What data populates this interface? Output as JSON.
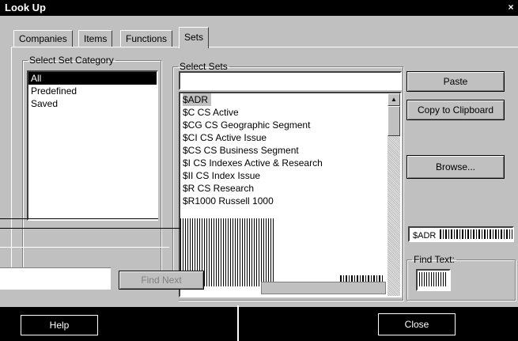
{
  "window": {
    "title": "Look Up",
    "close_glyph": "×"
  },
  "tabs": [
    {
      "label": "Companies",
      "active": false
    },
    {
      "label": "Items",
      "active": false
    },
    {
      "label": "Functions",
      "active": false
    },
    {
      "label": "Sets",
      "active": true
    }
  ],
  "category": {
    "legend": "Select Set Category",
    "items": [
      "All",
      "Predefined",
      "Saved"
    ],
    "selected": "All"
  },
  "sets": {
    "legend": "Select Sets",
    "search_value": "",
    "items": [
      "$ADR",
      "$C CS Active",
      "$CG CS Geographic Segment",
      "$CI CS Active Issue",
      "$CS CS Business Segment",
      "$I CS Indexes Active & Research",
      "$II CS Index Issue",
      "$R CS Research",
      "$R1000 Russell 1000"
    ],
    "selected": "$ADR"
  },
  "buttons": {
    "paste": "Paste",
    "copy": "Copy to Clipboard",
    "browse": "Browse...",
    "find_next": "Find Next",
    "help": "Help",
    "close": "Close"
  },
  "preview_value": "$ADR",
  "find_text": {
    "legend": "Find Text:",
    "value": ""
  }
}
